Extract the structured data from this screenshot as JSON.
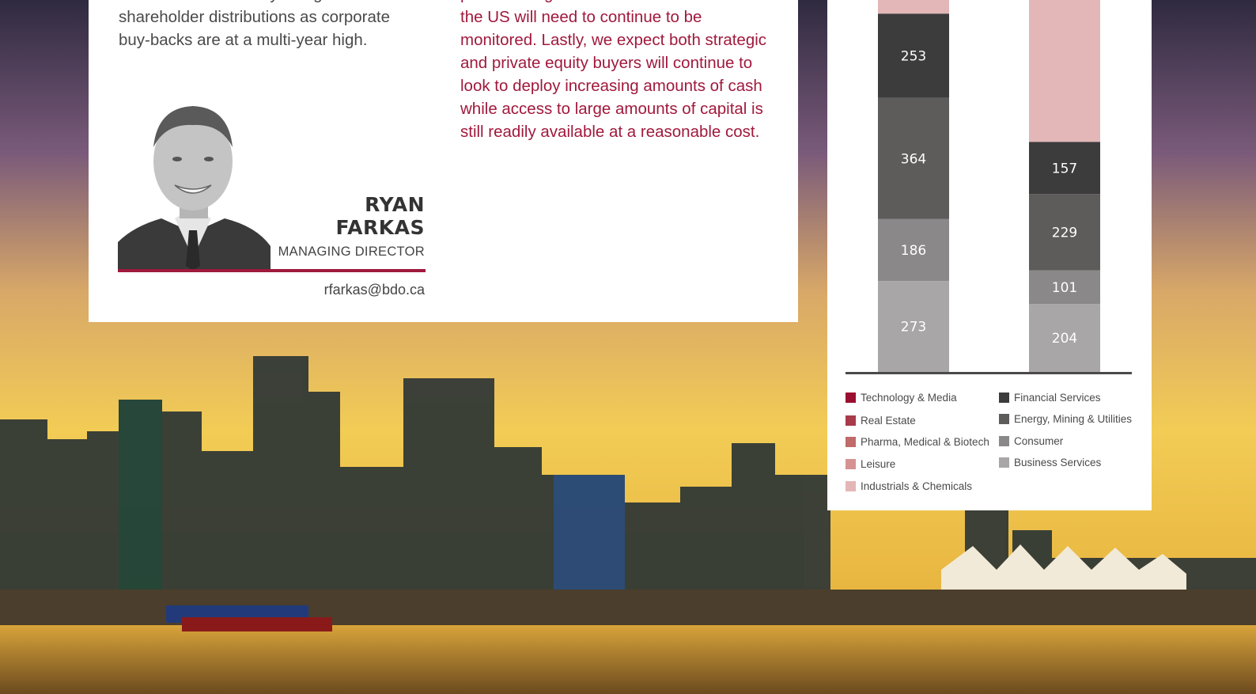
{
  "article": {
    "left_paragraph": "cash is almost entirely being used for shareholder distributions as corporate buy-backs are at a multi-year high.",
    "right_paragraph": "potential negative cross-border effects with the US will need to continue to be monitored. Lastly, we expect both strategic and private equity buyers will continue to look to deploy increasing amounts of cash while access to large amounts of capital is still readily available at a reasonable cost."
  },
  "contact": {
    "first_name": "RYAN",
    "last_name": "FARKAS",
    "title": "MANAGING DIRECTOR",
    "email": "rfarkas@bdo.ca"
  },
  "colors": {
    "accent": "#a0193c"
  },
  "chart_data": {
    "type": "bar",
    "stacked": true,
    "categories": [
      "",
      ""
    ],
    "series": [
      {
        "name": "Business Services",
        "color": "#a8a6a6",
        "values": [
          273,
          204
        ]
      },
      {
        "name": "Consumer",
        "color": "#8a8888",
        "values": [
          186,
          101
        ]
      },
      {
        "name": "Energy, Mining & Utilities",
        "color": "#5e5b5b",
        "values": [
          364,
          229
        ]
      },
      {
        "name": "Financial Services",
        "color": "#3c3c3c",
        "values": [
          253,
          157
        ]
      },
      {
        "name": "Industrials & Chemicals",
        "color": "#e3b7b7",
        "values": [
          null,
          null
        ]
      }
    ],
    "legend": [
      {
        "name": "Technology & Media",
        "color": "#9b0f30"
      },
      {
        "name": "Real Estate",
        "color": "#a83a4a"
      },
      {
        "name": "Pharma, Medical & Biotech",
        "color": "#c06a6a"
      },
      {
        "name": "Leisure",
        "color": "#d69292"
      },
      {
        "name": "Industrials & Chemicals",
        "color": "#e3b7b7"
      },
      {
        "name": "Financial Services",
        "color": "#3c3c3c"
      },
      {
        "name": "Energy, Mining & Utilities",
        "color": "#5e5b5b"
      },
      {
        "name": "Consumer",
        "color": "#8a8888"
      },
      {
        "name": "Business Services",
        "color": "#a8a6a6"
      }
    ],
    "legend_placement": "bottom",
    "grid": false
  }
}
